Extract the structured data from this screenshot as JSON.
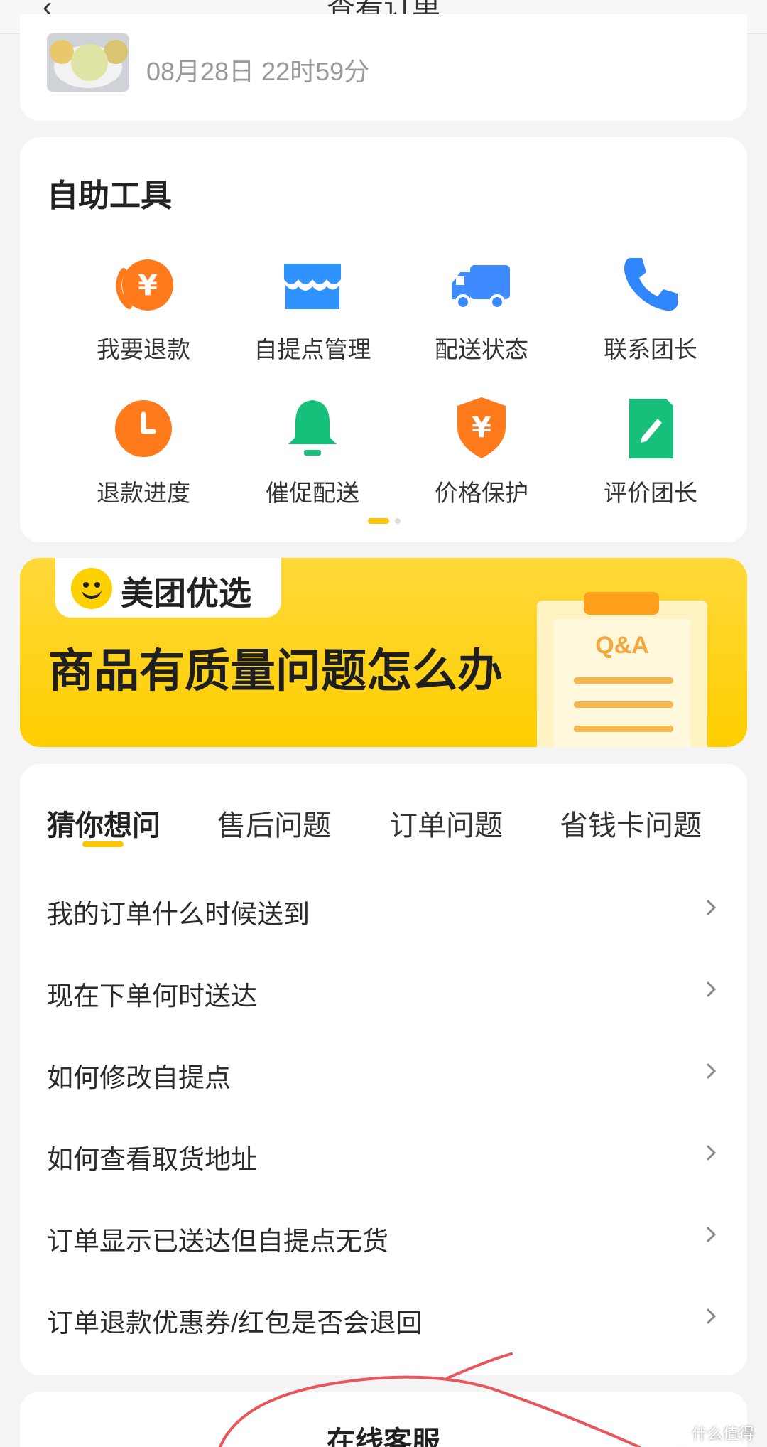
{
  "header": {
    "title": "查看订单",
    "back_glyph": "‹"
  },
  "order": {
    "time": "08月28日 22时59分"
  },
  "tools": {
    "title": "自助工具",
    "items": [
      {
        "label": "我要退款",
        "icon": "refund-yen-icon",
        "color": "#ff7a1a"
      },
      {
        "label": "自提点管理",
        "icon": "store-icon",
        "color": "#2f93ff"
      },
      {
        "label": "配送状态",
        "icon": "truck-icon",
        "color": "#3d8bff"
      },
      {
        "label": "联系团长",
        "icon": "phone-icon",
        "color": "#2f86ff"
      },
      {
        "label": "退款进度",
        "icon": "clock-icon",
        "color": "#ff7a1a"
      },
      {
        "label": "催促配送",
        "icon": "bell-icon",
        "color": "#17c07a"
      },
      {
        "label": "价格保护",
        "icon": "shield-yen-icon",
        "color": "#ff7a1a"
      },
      {
        "label": "评价团长",
        "icon": "edit-note-icon",
        "color": "#17c07a"
      }
    ]
  },
  "banner": {
    "brand": "美团优选",
    "headline": "商品有质量问题怎么办",
    "qa_badge": "Q&A"
  },
  "faq": {
    "tabs": [
      {
        "label": "猜你想问",
        "active": true
      },
      {
        "label": "售后问题",
        "active": false
      },
      {
        "label": "订单问题",
        "active": false
      },
      {
        "label": "省钱卡问题",
        "active": false
      }
    ],
    "questions": [
      "我的订单什么时候送到",
      "现在下单何时送达",
      "如何修改自提点",
      "如何查看取货地址",
      "订单显示已送达但自提点无货",
      "订单退款优惠券/红包是否会退回"
    ]
  },
  "service": {
    "label": "在线客服"
  },
  "watermark": {
    "text": "什么值得买"
  }
}
